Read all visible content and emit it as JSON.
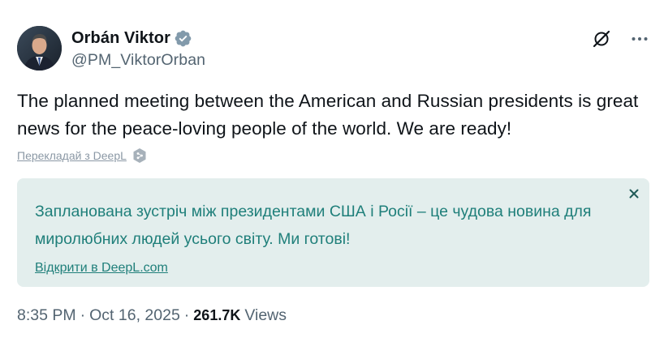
{
  "author": {
    "display_name": "Orbán Viktor",
    "handle": "@PM_ViktorOrban",
    "verified": true,
    "verified_color": "#829aab"
  },
  "tweet": {
    "text": "The planned meeting between the American and Russian presidents is great news for the peace-loving people of the world. We are ready!"
  },
  "translate": {
    "link_label": "Перекладай з DeepL"
  },
  "translation": {
    "text": "Запланована зустріч між президентами США і Росії – це чудова новина для миролюбних людей усього світу. Ми готові!",
    "open_label": "Відкрити в DeepL.com",
    "accent_color": "#1f7f7a",
    "background": "#e3eeed"
  },
  "meta": {
    "time": "8:35 PM",
    "date": "Oct 16, 2025",
    "separator": "·",
    "views_count": "261.7K",
    "views_label": "Views"
  },
  "icons": {
    "grok": "grok-icon",
    "more": "more-options-icon",
    "verified": "verified-badge-icon",
    "deepl": "deepl-icon",
    "close": "close-icon"
  }
}
